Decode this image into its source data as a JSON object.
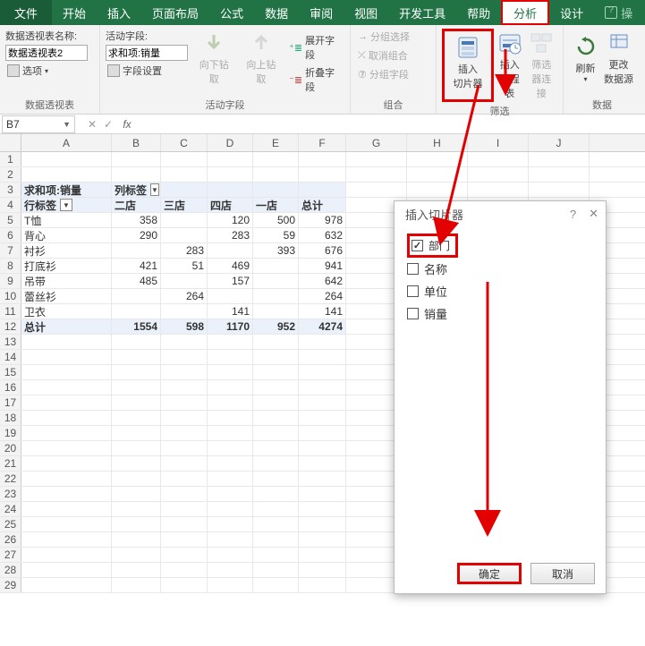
{
  "tabs": {
    "file": "文件",
    "home": "开始",
    "insert": "插入",
    "layout": "页面布局",
    "formula": "公式",
    "data": "数据",
    "review": "审阅",
    "view": "视图",
    "dev": "开发工具",
    "help": "帮助",
    "analyze": "分析",
    "design": "设计",
    "tell": "操"
  },
  "ribbon": {
    "pt_name_label": "数据透视表名称:",
    "pt_name_value": "数据透视表2",
    "pt_options": "选项",
    "group_pt": "数据透视表",
    "active_field_label": "活动字段:",
    "active_field_value": "求和项:销量",
    "field_settings": "字段设置",
    "group_active": "活动字段",
    "drill_down": "向下钻取",
    "drill_up": "向上钻取",
    "expand": "展开字段",
    "collapse": "折叠字段",
    "group_sel": "分组选择",
    "ungroup": "取消组合",
    "group_field": "分组字段",
    "group_group": "组合",
    "insert_slicer": "插入\n切片器",
    "insert_timeline": "插入\n日程表",
    "filter_conn": "筛选\n器连接",
    "group_filter": "筛选",
    "refresh": "刷新",
    "change_src": "更改\n数据源",
    "group_data": "数据"
  },
  "namebox": "B7",
  "pivot": {
    "corner": "求和项:销量",
    "col_label": "列标签",
    "row_label": "行标签",
    "cols": [
      "二店",
      "三店",
      "四店",
      "一店",
      "总计"
    ],
    "rows": [
      {
        "label": "T恤",
        "v": [
          "358",
          "",
          "120",
          "500",
          "978"
        ]
      },
      {
        "label": "背心",
        "v": [
          "290",
          "",
          "283",
          "59",
          "632"
        ]
      },
      {
        "label": "衬衫",
        "v": [
          "",
          "283",
          "",
          "393",
          "676"
        ]
      },
      {
        "label": "打底衫",
        "v": [
          "421",
          "51",
          "469",
          "",
          "941"
        ]
      },
      {
        "label": "吊带",
        "v": [
          "485",
          "",
          "157",
          "",
          "642"
        ]
      },
      {
        "label": "蕾丝衫",
        "v": [
          "",
          "264",
          "",
          "",
          "264"
        ]
      },
      {
        "label": "卫衣",
        "v": [
          "",
          "",
          "141",
          "",
          "141"
        ]
      }
    ],
    "total_label": "总计",
    "totals": [
      "1554",
      "598",
      "1170",
      "952",
      "4274"
    ]
  },
  "dialog": {
    "title": "插入切片器",
    "help": "?",
    "close": "✕",
    "items": [
      {
        "label": "部门",
        "checked": true,
        "hl": true
      },
      {
        "label": "名称",
        "checked": false
      },
      {
        "label": "单位",
        "checked": false
      },
      {
        "label": "销量",
        "checked": false
      }
    ],
    "ok": "确定",
    "cancel": "取消"
  },
  "columns": [
    "A",
    "B",
    "C",
    "D",
    "E",
    "F",
    "G",
    "H",
    "I",
    "J"
  ]
}
